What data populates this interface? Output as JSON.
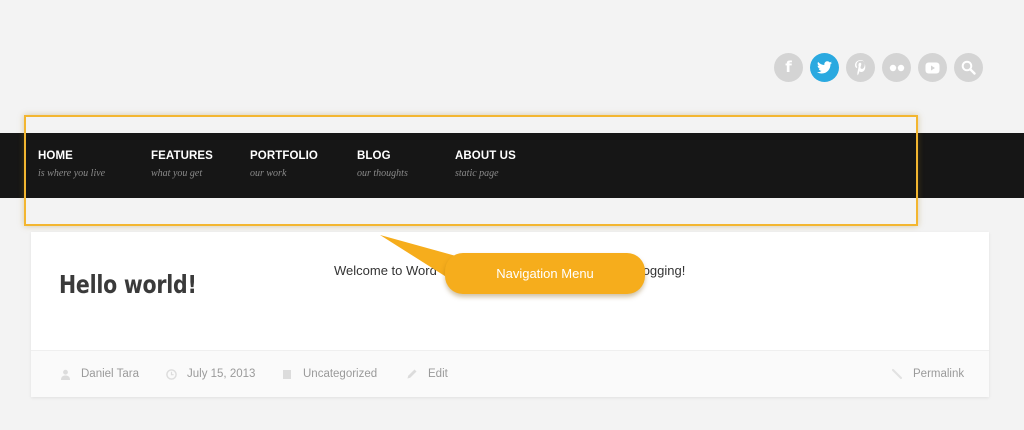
{
  "social": {
    "icons": [
      "facebook-icon",
      "twitter-icon",
      "pinterest-icon",
      "flickr-icon",
      "youtube-icon",
      "search-icon"
    ],
    "active": "twitter-icon",
    "colors": {
      "inactive": "#d4d4d4",
      "active": "#2aa9e0"
    }
  },
  "nav": {
    "items": [
      {
        "label": "HOME",
        "sub": "is where you live"
      },
      {
        "label": "FEATURES",
        "sub": "what you get"
      },
      {
        "label": "PORTFOLIO",
        "sub": "our work"
      },
      {
        "label": "BLOG",
        "sub": "our thoughts"
      },
      {
        "label": "ABOUT US",
        "sub": "static page"
      }
    ],
    "background": "#161616"
  },
  "annotation": {
    "label": "Navigation Menu",
    "color": "#f6ad1c",
    "frame_color": "#f3b630"
  },
  "post": {
    "title": "Hello world!",
    "content_start": "Welcome to Word",
    "content_end": "or delete it, then start blogging!",
    "meta": {
      "author": "Daniel Tara",
      "date": "July 15, 2013",
      "category": "Uncategorized",
      "edit": "Edit",
      "permalink": "Permalink"
    }
  }
}
